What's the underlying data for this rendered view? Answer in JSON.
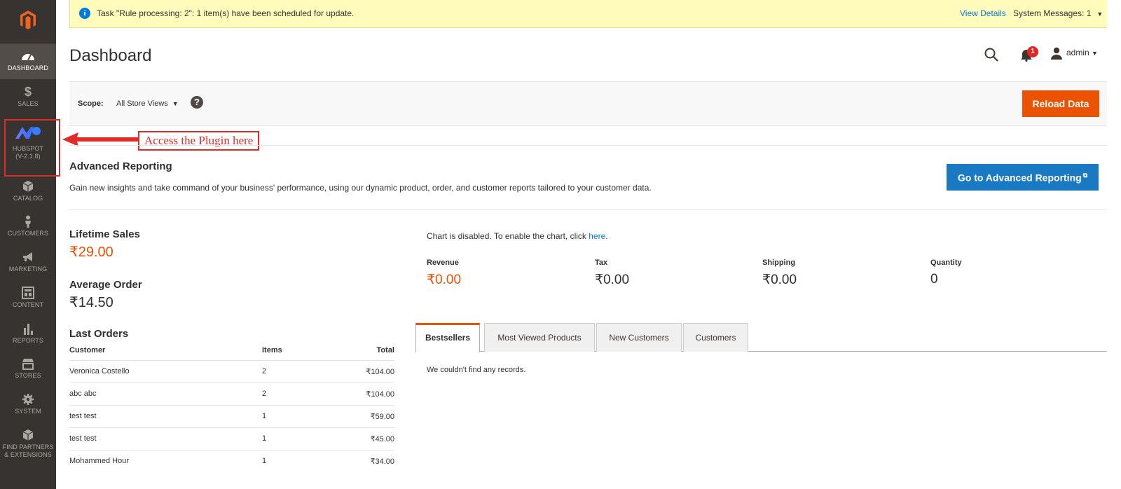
{
  "sidebar": {
    "logo_icon": "magento-logo-icon",
    "items": [
      {
        "key": "dashboard",
        "label": "DASHBOARD",
        "icon": "dashboard-gauge-icon"
      },
      {
        "key": "sales",
        "label": "SALES",
        "icon": "dollar-icon"
      },
      {
        "key": "hubspot",
        "label": "HUBSPOT",
        "label2": "(V-2.1.8)",
        "icon": "hubspot-plugin-icon"
      },
      {
        "key": "catalog",
        "label": "CATALOG",
        "icon": "box-icon"
      },
      {
        "key": "customers",
        "label": "CUSTOMERS",
        "icon": "person-icon"
      },
      {
        "key": "marketing",
        "label": "MARKETING",
        "icon": "megaphone-icon"
      },
      {
        "key": "content",
        "label": "CONTENT",
        "icon": "layout-icon"
      },
      {
        "key": "reports",
        "label": "REPORTS",
        "icon": "bar-chart-icon"
      },
      {
        "key": "stores",
        "label": "STORES",
        "icon": "storefront-icon"
      },
      {
        "key": "system",
        "label": "SYSTEM",
        "icon": "gear-icon"
      },
      {
        "key": "partners",
        "label": "FIND PARTNERS",
        "label2": "& EXTENSIONS",
        "icon": "cube-icon"
      }
    ]
  },
  "annotation": {
    "text": "Access the Plugin here"
  },
  "message_bar": {
    "text": "Task \"Rule processing: 2\": 1 item(s) have been scheduled for update.",
    "view_details": "View Details",
    "system_messages": "System Messages: 1"
  },
  "header": {
    "title": "Dashboard",
    "notification_count": "1",
    "user": "admin"
  },
  "scope": {
    "label": "Scope:",
    "value": "All Store Views",
    "reload_button": "Reload Data"
  },
  "advanced_reporting": {
    "title": "Advanced Reporting",
    "description": "Gain new insights and take command of your business' performance, using our dynamic product, order, and customer reports tailored to your customer data.",
    "button": "Go to Advanced Reporting"
  },
  "stats": {
    "lifetime_sales_label": "Lifetime Sales",
    "lifetime_sales_value": "₹29.00",
    "average_order_label": "Average Order",
    "average_order_value": "₹14.50"
  },
  "last_orders": {
    "title": "Last Orders",
    "columns": [
      "Customer",
      "Items",
      "Total"
    ],
    "rows": [
      {
        "customer": "Veronica Costello",
        "items": "2",
        "total": "₹104.00"
      },
      {
        "customer": "abc abc",
        "items": "2",
        "total": "₹104.00"
      },
      {
        "customer": "test test",
        "items": "1",
        "total": "₹59.00"
      },
      {
        "customer": "test test",
        "items": "1",
        "total": "₹45.00"
      },
      {
        "customer": "Mohammed Hour",
        "items": "1",
        "total": "₹34.00"
      }
    ]
  },
  "chart": {
    "message": "Chart is disabled. To enable the chart, click ",
    "link": "here",
    "period": "."
  },
  "totals": [
    {
      "label": "Revenue",
      "value": "₹0.00"
    },
    {
      "label": "Tax",
      "value": "₹0.00"
    },
    {
      "label": "Shipping",
      "value": "₹0.00"
    },
    {
      "label": "Quantity",
      "value": "0"
    }
  ],
  "tabs": [
    {
      "label": "Bestsellers",
      "active": true
    },
    {
      "label": "Most Viewed Products",
      "active": false
    },
    {
      "label": "New Customers",
      "active": false
    },
    {
      "label": "Customers",
      "active": false
    }
  ],
  "tab_content": {
    "empty": "We couldn't find any records."
  },
  "colors": {
    "sidebar_bg": "#373330",
    "accent_orange": "#eb5202",
    "link_blue": "#007bdb",
    "button_blue": "#1979c3",
    "message_bg": "#fffbbb",
    "annotation_red": "#e02b27"
  }
}
